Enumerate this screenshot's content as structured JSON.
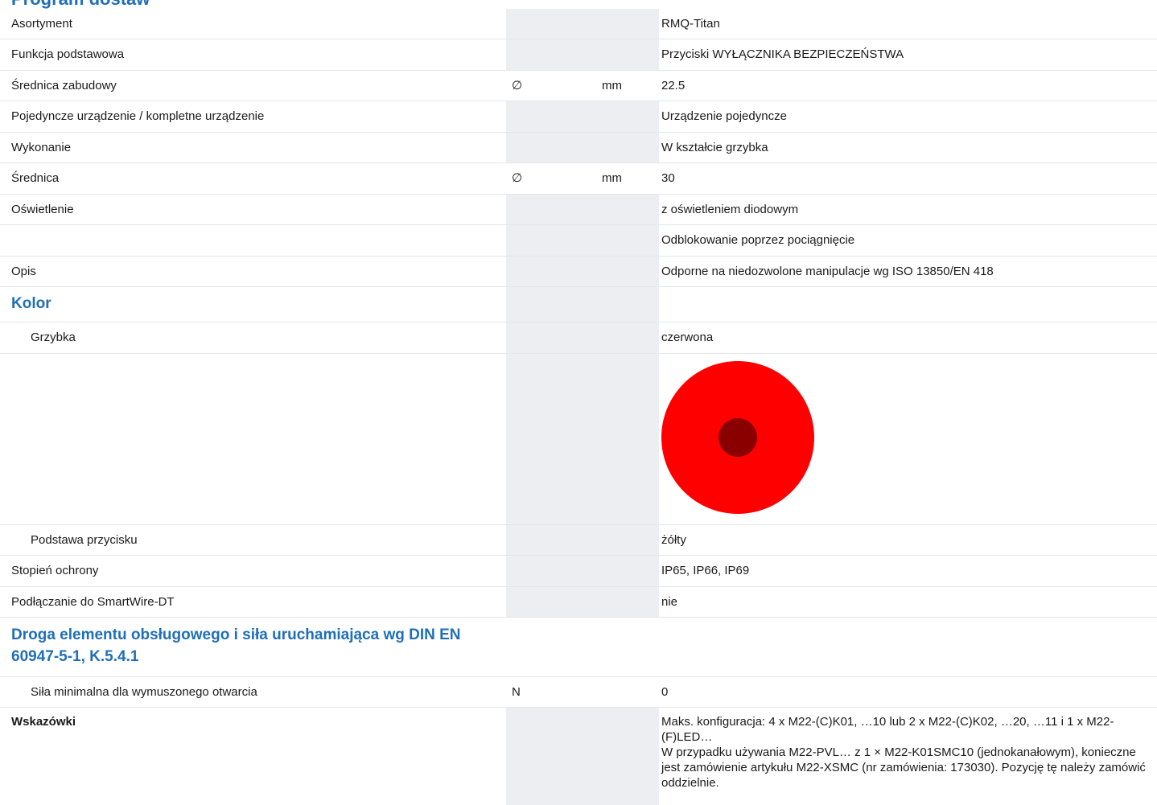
{
  "heading": "Program dostaw",
  "rows": {
    "asortyment": {
      "label": "Asortyment",
      "value": "RMQ-Titan"
    },
    "funkcja": {
      "label": "Funkcja podstawowa",
      "value": "Przyciski WYŁĄCZNIKA BEZPIECZEŃSTWA"
    },
    "srednica_zab": {
      "label": "Średnica zabudowy",
      "symbol": "∅",
      "unit": "mm",
      "value": "22.5"
    },
    "pojedyncze": {
      "label": "Pojedyncze urządzenie / kompletne urządzenie",
      "value": "Urządzenie pojedyncze"
    },
    "wykonanie": {
      "label": "Wykonanie",
      "value": "W kształcie grzybka"
    },
    "srednica": {
      "label": "Średnica",
      "symbol": "∅",
      "unit": "mm",
      "value": "30"
    },
    "oswietlenie": {
      "label": "Oświetlenie",
      "value": "z oświetleniem diodowym"
    },
    "odblokowanie": {
      "label": "",
      "value": "Odblokowanie poprzez pociągnięcie"
    },
    "opis": {
      "label": "Opis",
      "value": "Odporne na niedozwolone manipulacje wg ISO 13850/EN 418"
    },
    "kolor_section": {
      "label": "Kolor"
    },
    "grzybka": {
      "label": "Grzybka",
      "value": "czerwona"
    },
    "podstawa": {
      "label": "Podstawa przycisku",
      "value": "żółty"
    },
    "stopien": {
      "label": "Stopień ochrony",
      "value": "IP65, IP66, IP69"
    },
    "smartwire": {
      "label": "Podłączanie do SmartWire-DT",
      "value": "nie"
    },
    "droga_section": {
      "label": "Droga elementu obsługowego i siła uruchamiająca wg DIN EN 60947-5-1, K.5.4.1"
    },
    "sila": {
      "label": "Siła minimalna dla wymuszonego otwarcia",
      "symbol": "N",
      "value": "0"
    },
    "wskazowki": {
      "label": "Wskazówki",
      "value_line1": "Maks. konfiguracja: 4 x M22-(C)K01, …10 lub 2 x M22-(C)K02, …20, …11 i 1 x M22-(F)LED…",
      "value_line2": "W przypadku używania M22-PVL… z 1 × M22-K01SMC10 (jednokanałowym), konieczne jest zamówienie artykułu M22-XSMC (nr zamówienia: 173030). Pozycję tę należy zamówić oddzielnie."
    }
  },
  "colors": {
    "section_blue": "#1f6fb8",
    "mushroom_red": "#ff0000",
    "mushroom_center": "#8a0000",
    "unit_column_bg": "#eceef1"
  }
}
